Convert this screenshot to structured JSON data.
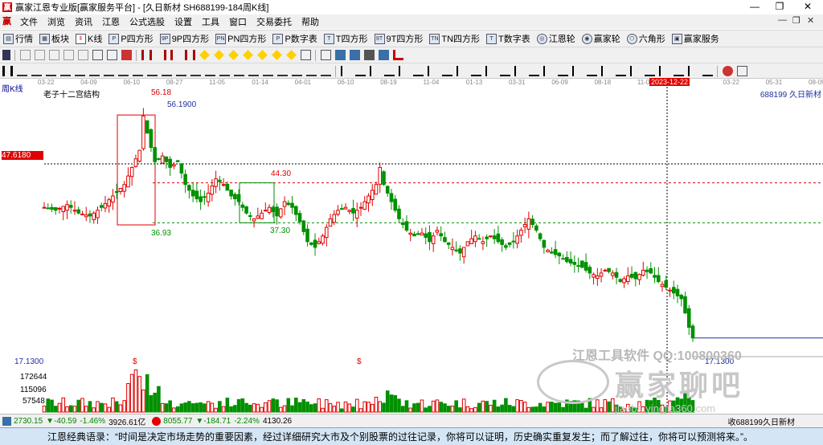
{
  "window": {
    "app_title": "赢家江恩专业版[赢家服务平台] - [久日新材  SH688199-184周K线]",
    "minimize": "—",
    "restore": "❐",
    "close": "✕"
  },
  "menu": {
    "items": [
      "文件",
      "浏览",
      "资讯",
      "江恩",
      "公式选股",
      "设置",
      "工具",
      "窗口",
      "交易委托",
      "帮助"
    ],
    "inner_controls": [
      "—",
      "❐",
      "✕"
    ]
  },
  "toolbar": {
    "items": [
      {
        "icon": "quote-icon",
        "label": "行情"
      },
      {
        "icon": "sector-icon",
        "label": "板块"
      },
      {
        "icon": "kline-icon",
        "label": "K线"
      },
      {
        "icon": "p-square-icon",
        "label": "P四方形"
      },
      {
        "icon": "9p-square-icon",
        "label": "9P四方形"
      },
      {
        "icon": "pn-square-icon",
        "label": "PN四方形"
      },
      {
        "icon": "p-number-table-icon",
        "label": "P数字表"
      },
      {
        "icon": "t-square-icon",
        "label": "T四方形"
      },
      {
        "icon": "9t-square-icon",
        "label": "9T四方形"
      },
      {
        "icon": "tn-square-icon",
        "label": "TN四方形"
      },
      {
        "icon": "t-number-table-icon",
        "label": "T数字表"
      },
      {
        "icon": "gann-wheel-icon",
        "label": "江恩轮"
      },
      {
        "icon": "winner-wheel-icon",
        "label": "赢家轮"
      },
      {
        "icon": "hexagon-icon",
        "label": "六角形"
      },
      {
        "icon": "winner-service-icon",
        "label": "赢家服务"
      }
    ]
  },
  "chart_header": {
    "period_label": "周K线",
    "indicator_name": "老子十二宫结构",
    "stock_code_name": "688199 久日新材",
    "time_axis": [
      "03-22",
      "04-09",
      "06-10",
      "08-27",
      "11-05",
      "01-14",
      "04-01",
      "06-10",
      "08-19",
      "11-04",
      "01-13",
      "03-31",
      "06-09",
      "08-18",
      "11-03",
      "2023-12-22",
      "03-22",
      "05-31",
      "08-09"
    ],
    "crosshair_date": "2023-12-22",
    "crosshair_price": "47.6180"
  },
  "chart_data": {
    "type": "candlestick",
    "title": "老子十二宫结构",
    "annotations": {
      "high_label": "56.18",
      "high_value_label": "56.1900",
      "resistance_label": "44.30",
      "support_label": "37.30",
      "low_label": "36.93",
      "last_price_label": "17.1300",
      "crosshair_price": "47.6180"
    },
    "ylim": [
      14,
      60
    ],
    "anchor_points": [
      [
        0,
        40
      ],
      [
        3,
        39.5
      ],
      [
        6,
        40.5
      ],
      [
        9,
        39
      ],
      [
        12,
        38.5
      ],
      [
        15,
        40
      ],
      [
        18,
        42
      ],
      [
        21,
        44
      ],
      [
        23,
        47
      ],
      [
        25,
        50
      ],
      [
        26,
        56
      ],
      [
        27,
        53
      ],
      [
        29,
        48
      ],
      [
        31,
        49
      ],
      [
        33,
        47
      ],
      [
        35,
        48
      ],
      [
        37,
        44
      ],
      [
        39,
        42
      ],
      [
        41,
        41
      ],
      [
        43,
        42.5
      ],
      [
        45,
        45
      ],
      [
        47,
        44
      ],
      [
        49,
        42
      ],
      [
        51,
        41
      ],
      [
        53,
        39
      ],
      [
        55,
        38
      ],
      [
        57,
        39
      ],
      [
        59,
        40
      ],
      [
        61,
        38.5
      ],
      [
        63,
        41
      ],
      [
        65,
        40
      ],
      [
        67,
        37.5
      ],
      [
        69,
        34
      ],
      [
        71,
        33
      ],
      [
        73,
        35
      ],
      [
        75,
        38
      ],
      [
        77,
        39.5
      ],
      [
        79,
        40
      ],
      [
        81,
        39
      ],
      [
        83,
        40
      ],
      [
        85,
        42
      ],
      [
        87,
        44
      ],
      [
        88,
        47
      ],
      [
        89,
        44
      ],
      [
        91,
        41
      ],
      [
        93,
        38
      ],
      [
        95,
        36
      ],
      [
        97,
        35
      ],
      [
        99,
        35.5
      ],
      [
        101,
        34
      ],
      [
        103,
        36
      ],
      [
        105,
        34
      ],
      [
        107,
        33
      ],
      [
        109,
        32
      ],
      [
        111,
        34
      ],
      [
        113,
        35
      ],
      [
        115,
        34
      ],
      [
        117,
        35
      ],
      [
        119,
        34
      ],
      [
        121,
        33
      ],
      [
        123,
        34
      ],
      [
        125,
        36
      ],
      [
        127,
        38
      ],
      [
        129,
        36
      ],
      [
        131,
        33
      ],
      [
        133,
        32
      ],
      [
        135,
        31.5
      ],
      [
        137,
        30.5
      ],
      [
        139,
        30
      ],
      [
        141,
        29.5
      ],
      [
        143,
        28.5
      ],
      [
        145,
        28
      ],
      [
        147,
        29
      ],
      [
        149,
        28.5
      ],
      [
        151,
        27
      ],
      [
        153,
        28
      ],
      [
        155,
        27.5
      ],
      [
        157,
        29
      ],
      [
        159,
        28.5
      ],
      [
        161,
        27
      ],
      [
        163,
        26
      ],
      [
        165,
        25
      ],
      [
        167,
        24
      ],
      [
        169,
        19
      ],
      [
        170,
        17.13
      ]
    ],
    "volume_axis": [
      "172644",
      "115096",
      "57548"
    ],
    "volume_markers": [
      "$",
      "$"
    ]
  },
  "statusbar": {
    "sh_index": "2730.15",
    "sh_change": "▼-40.59",
    "sh_pct": "-1.46%",
    "sh_amount": "3926.61亿",
    "sz_index": "8055.77",
    "sz_change": "▼-184.71",
    "sz_pct": "-2.24%",
    "sz_amount": "4130.26",
    "right_text": "收688199久日新材"
  },
  "quote": {
    "text": "江恩经典语录：“时间是决定市场走势的重要因素，经过详细研究大市及个别股票的过往记录，你将可以证明，历史确实重复发生；而了解过往，你将可以预测将来。”。"
  },
  "watermark": {
    "line1": "江恩工具软件  QQ:100800360",
    "line2": "赢家聊吧",
    "line3": "jiaoba.yingjia360.com"
  },
  "colors": {
    "up": "#e00000",
    "down": "#009000",
    "crosshair_tag": "#e00000",
    "resistance_line": "#e00000",
    "support_line": "#009000",
    "box_red": "#e00000",
    "box_green": "#009000",
    "value_blue": "#2030a0"
  }
}
